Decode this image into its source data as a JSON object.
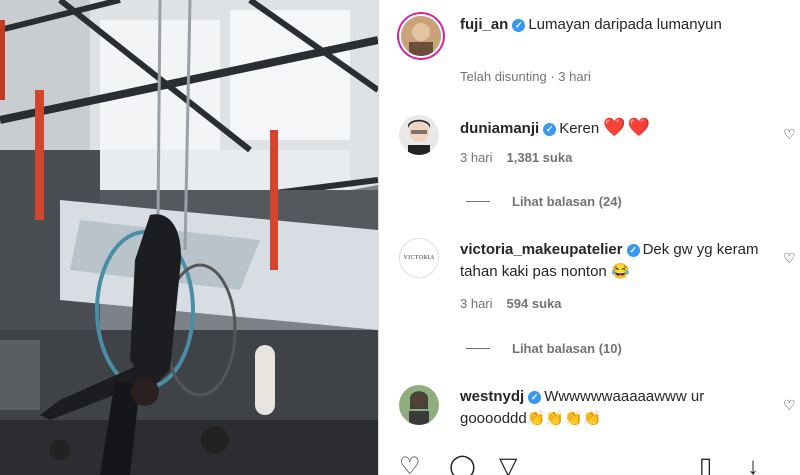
{
  "caption": {
    "username": "fuji_an",
    "text": "Lumayan daripada lumanyun",
    "meta": "Telah disunting · 3 hari"
  },
  "comments": [
    {
      "username": "duniamanji",
      "text": "Keren",
      "emoji": "❤️❤️",
      "time": "3 hari",
      "likes": "1,381 suka",
      "replies": "Lihat balasan (24)"
    },
    {
      "username": "victoria_makeupatelier",
      "text": "Dek gw yg keram tahan kaki pas nonton 😂",
      "avatar_text": "VICTORIA",
      "time": "3 hari",
      "likes": "594 suka",
      "replies": "Lihat balasan (10)"
    },
    {
      "username": "westnydj",
      "text": "Wwwwwwaaaaawww ur gooooddd👏👏👏👏"
    }
  ],
  "icons": {
    "like": "heart-icon",
    "comment": "comment-icon",
    "share": "share-icon",
    "save": "bookmark-icon",
    "more": "download-icon"
  },
  "colors": {
    "verified": "#3897f0",
    "heart_red": "#e0245e",
    "muted": "#737373"
  }
}
